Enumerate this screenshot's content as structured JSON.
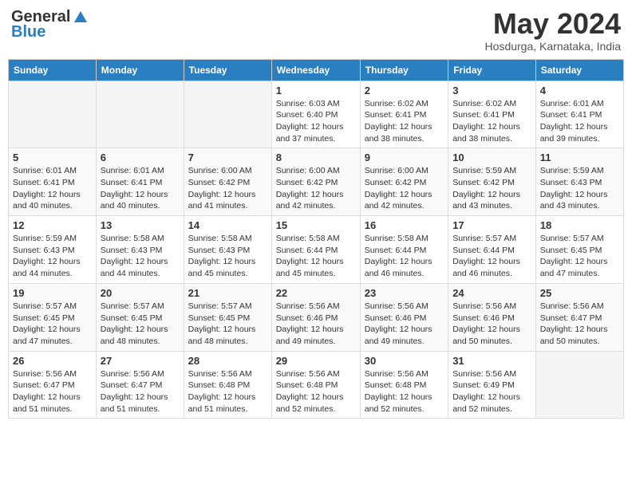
{
  "logo": {
    "general": "General",
    "blue": "Blue"
  },
  "title": {
    "month_year": "May 2024",
    "location": "Hosdurga, Karnataka, India"
  },
  "weekdays": [
    "Sunday",
    "Monday",
    "Tuesday",
    "Wednesday",
    "Thursday",
    "Friday",
    "Saturday"
  ],
  "weeks": [
    [
      {
        "day": "",
        "info": ""
      },
      {
        "day": "",
        "info": ""
      },
      {
        "day": "",
        "info": ""
      },
      {
        "day": "1",
        "info": "Sunrise: 6:03 AM\nSunset: 6:40 PM\nDaylight: 12 hours\nand 37 minutes."
      },
      {
        "day": "2",
        "info": "Sunrise: 6:02 AM\nSunset: 6:41 PM\nDaylight: 12 hours\nand 38 minutes."
      },
      {
        "day": "3",
        "info": "Sunrise: 6:02 AM\nSunset: 6:41 PM\nDaylight: 12 hours\nand 38 minutes."
      },
      {
        "day": "4",
        "info": "Sunrise: 6:01 AM\nSunset: 6:41 PM\nDaylight: 12 hours\nand 39 minutes."
      }
    ],
    [
      {
        "day": "5",
        "info": "Sunrise: 6:01 AM\nSunset: 6:41 PM\nDaylight: 12 hours\nand 40 minutes."
      },
      {
        "day": "6",
        "info": "Sunrise: 6:01 AM\nSunset: 6:41 PM\nDaylight: 12 hours\nand 40 minutes."
      },
      {
        "day": "7",
        "info": "Sunrise: 6:00 AM\nSunset: 6:42 PM\nDaylight: 12 hours\nand 41 minutes."
      },
      {
        "day": "8",
        "info": "Sunrise: 6:00 AM\nSunset: 6:42 PM\nDaylight: 12 hours\nand 42 minutes."
      },
      {
        "day": "9",
        "info": "Sunrise: 6:00 AM\nSunset: 6:42 PM\nDaylight: 12 hours\nand 42 minutes."
      },
      {
        "day": "10",
        "info": "Sunrise: 5:59 AM\nSunset: 6:42 PM\nDaylight: 12 hours\nand 43 minutes."
      },
      {
        "day": "11",
        "info": "Sunrise: 5:59 AM\nSunset: 6:43 PM\nDaylight: 12 hours\nand 43 minutes."
      }
    ],
    [
      {
        "day": "12",
        "info": "Sunrise: 5:59 AM\nSunset: 6:43 PM\nDaylight: 12 hours\nand 44 minutes."
      },
      {
        "day": "13",
        "info": "Sunrise: 5:58 AM\nSunset: 6:43 PM\nDaylight: 12 hours\nand 44 minutes."
      },
      {
        "day": "14",
        "info": "Sunrise: 5:58 AM\nSunset: 6:43 PM\nDaylight: 12 hours\nand 45 minutes."
      },
      {
        "day": "15",
        "info": "Sunrise: 5:58 AM\nSunset: 6:44 PM\nDaylight: 12 hours\nand 45 minutes."
      },
      {
        "day": "16",
        "info": "Sunrise: 5:58 AM\nSunset: 6:44 PM\nDaylight: 12 hours\nand 46 minutes."
      },
      {
        "day": "17",
        "info": "Sunrise: 5:57 AM\nSunset: 6:44 PM\nDaylight: 12 hours\nand 46 minutes."
      },
      {
        "day": "18",
        "info": "Sunrise: 5:57 AM\nSunset: 6:45 PM\nDaylight: 12 hours\nand 47 minutes."
      }
    ],
    [
      {
        "day": "19",
        "info": "Sunrise: 5:57 AM\nSunset: 6:45 PM\nDaylight: 12 hours\nand 47 minutes."
      },
      {
        "day": "20",
        "info": "Sunrise: 5:57 AM\nSunset: 6:45 PM\nDaylight: 12 hours\nand 48 minutes."
      },
      {
        "day": "21",
        "info": "Sunrise: 5:57 AM\nSunset: 6:45 PM\nDaylight: 12 hours\nand 48 minutes."
      },
      {
        "day": "22",
        "info": "Sunrise: 5:56 AM\nSunset: 6:46 PM\nDaylight: 12 hours\nand 49 minutes."
      },
      {
        "day": "23",
        "info": "Sunrise: 5:56 AM\nSunset: 6:46 PM\nDaylight: 12 hours\nand 49 minutes."
      },
      {
        "day": "24",
        "info": "Sunrise: 5:56 AM\nSunset: 6:46 PM\nDaylight: 12 hours\nand 50 minutes."
      },
      {
        "day": "25",
        "info": "Sunrise: 5:56 AM\nSunset: 6:47 PM\nDaylight: 12 hours\nand 50 minutes."
      }
    ],
    [
      {
        "day": "26",
        "info": "Sunrise: 5:56 AM\nSunset: 6:47 PM\nDaylight: 12 hours\nand 51 minutes."
      },
      {
        "day": "27",
        "info": "Sunrise: 5:56 AM\nSunset: 6:47 PM\nDaylight: 12 hours\nand 51 minutes."
      },
      {
        "day": "28",
        "info": "Sunrise: 5:56 AM\nSunset: 6:48 PM\nDaylight: 12 hours\nand 51 minutes."
      },
      {
        "day": "29",
        "info": "Sunrise: 5:56 AM\nSunset: 6:48 PM\nDaylight: 12 hours\nand 52 minutes."
      },
      {
        "day": "30",
        "info": "Sunrise: 5:56 AM\nSunset: 6:48 PM\nDaylight: 12 hours\nand 52 minutes."
      },
      {
        "day": "31",
        "info": "Sunrise: 5:56 AM\nSunset: 6:49 PM\nDaylight: 12 hours\nand 52 minutes."
      },
      {
        "day": "",
        "info": ""
      }
    ]
  ]
}
